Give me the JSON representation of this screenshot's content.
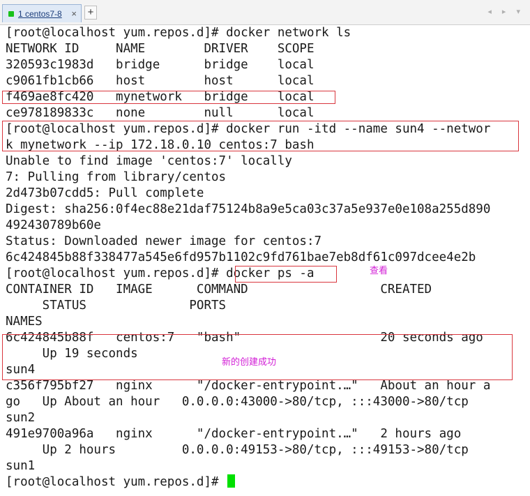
{
  "tab": {
    "title": "1 centos7-8",
    "close": "×",
    "add": "+"
  },
  "nav": {
    "arrows": "◂ ▸ ▾"
  },
  "terminal": {
    "lines": [
      "[root@localhost yum.repos.d]# docker network ls",
      "NETWORK ID     NAME        DRIVER    SCOPE",
      "320593c1983d   bridge      bridge    local",
      "c9061fb1cb66   host        host      local",
      "f469ae8fc420   mynetwork   bridge    local",
      "ce978189833c   none        null      local",
      "[root@localhost yum.repos.d]# docker run -itd --name sun4 --networ",
      "k mynetwork --ip 172.18.0.10 centos:7 bash",
      "Unable to find image 'centos:7' locally",
      "7: Pulling from library/centos",
      "2d473b07cdd5: Pull complete",
      "Digest: sha256:0f4ec88e21daf75124b8a9e5ca03c37a5e937e0e108a255d890",
      "492430789b60e",
      "Status: Downloaded newer image for centos:7",
      "6c424845b88f338477a545e6fd957b1102c9fd761bae7eb8df61c097dcee4e2b",
      "[root@localhost yum.repos.d]# docker ps -a",
      "CONTAINER ID   IMAGE      COMMAND                  CREATED",
      "     STATUS              PORTS",
      "NAMES",
      "6c424845b88f   centos:7   \"bash\"                   20 seconds ago",
      "     Up 19 seconds",
      "sun4",
      "c356f795bf27   nginx      \"/docker-entrypoint.…\"   About an hour a",
      "go   Up About an hour   0.0.0.0:43000->80/tcp, :::43000->80/tcp",
      "sun2",
      "491e9700a96a   nginx      \"/docker-entrypoint.…\"   2 hours ago",
      "     Up 2 hours         0.0.0.0:49153->80/tcp, :::49153->80/tcp",
      "sun1",
      "[root@localhost yum.repos.d]# "
    ]
  },
  "annotations": {
    "view": "查看",
    "created": "新的创建成功"
  },
  "colors": {
    "highlight_box": "#d9363e",
    "annotation": "#d21ed6",
    "cursor": "#00e000"
  }
}
